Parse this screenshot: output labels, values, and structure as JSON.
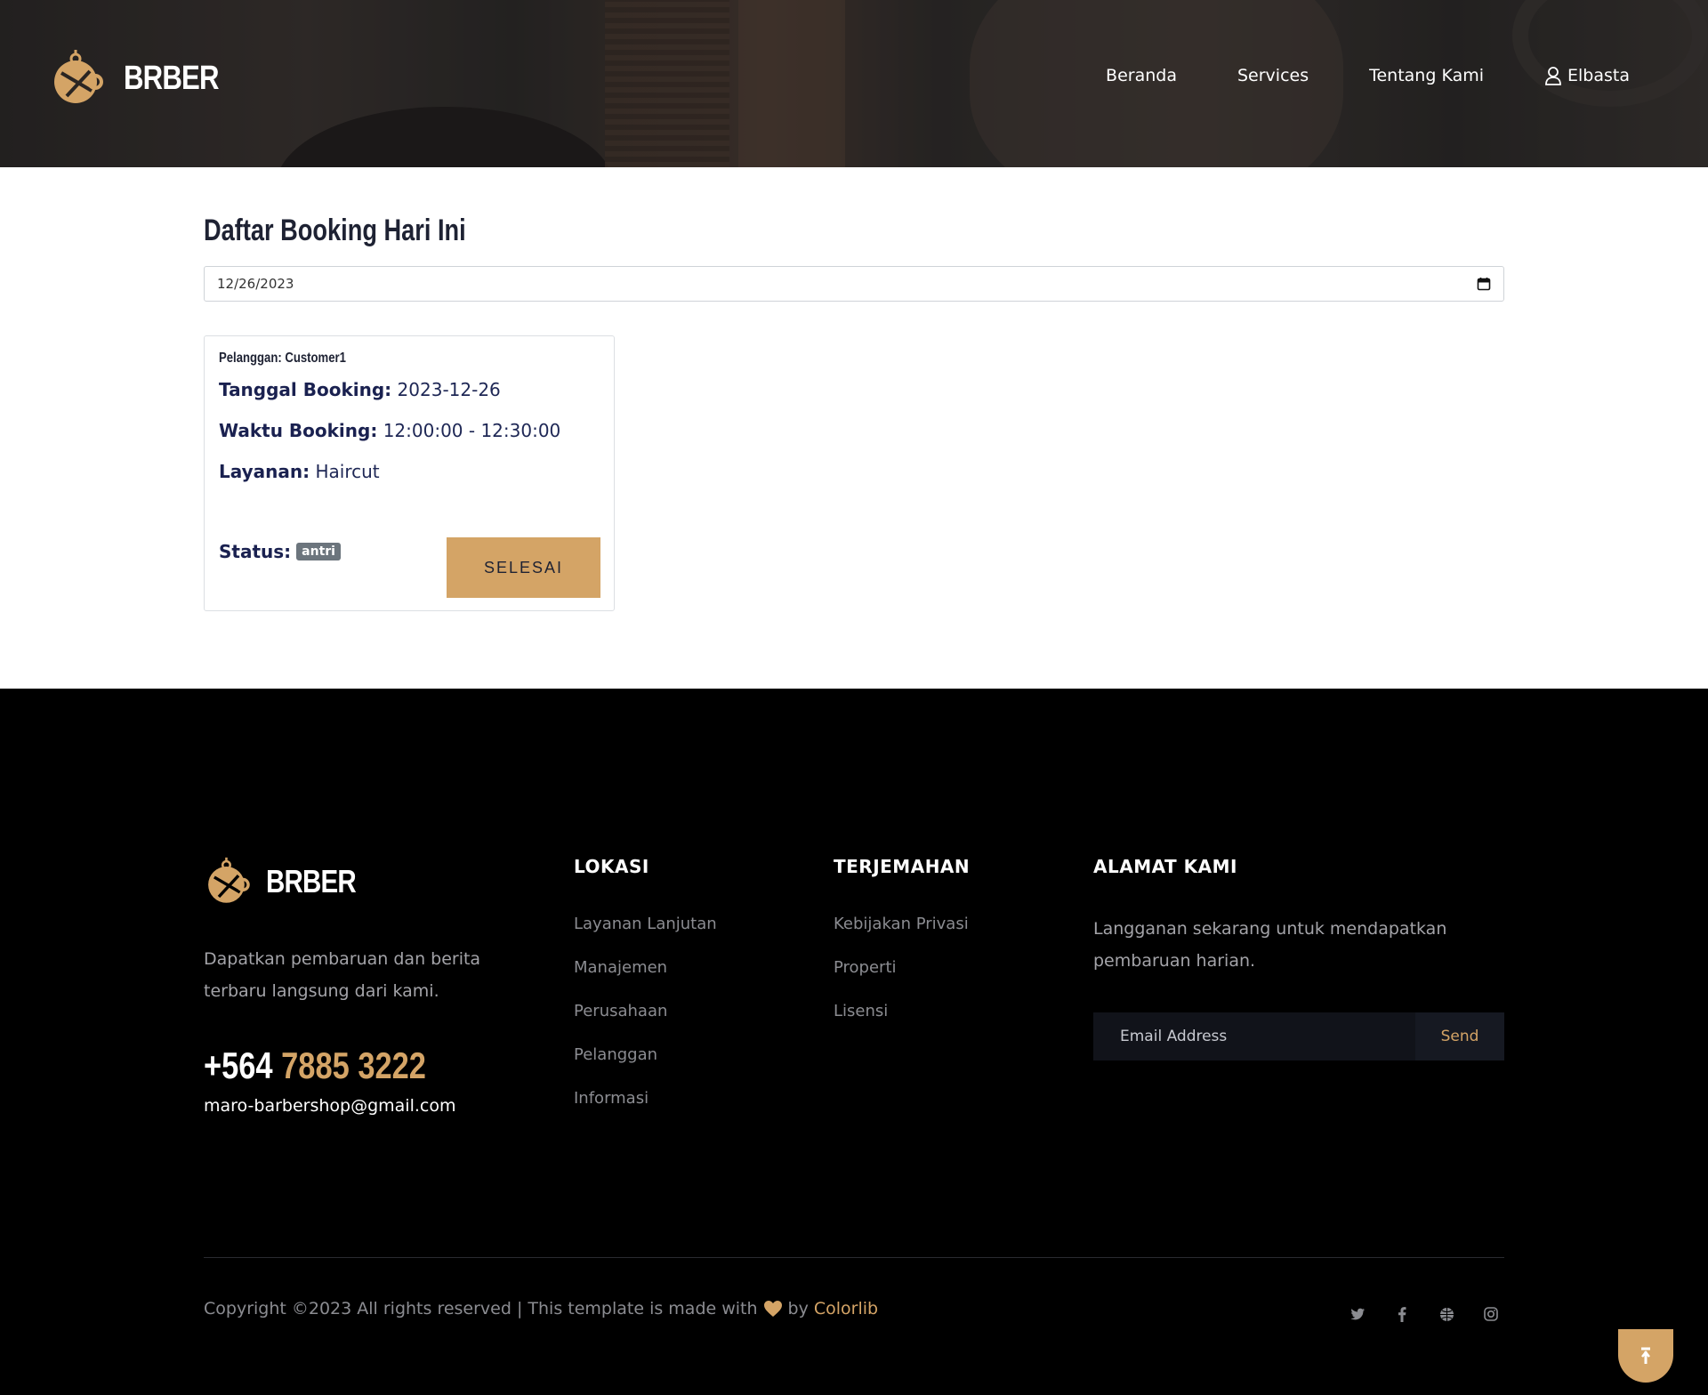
{
  "header": {
    "brand": "BRBER",
    "nav": [
      {
        "label": "Beranda"
      },
      {
        "label": "Services"
      },
      {
        "label": "Tentang Kami"
      },
      {
        "label": "Elbasta"
      }
    ]
  },
  "main": {
    "title": "Daftar Booking Hari Ini",
    "date_value": "12/26/2023",
    "booking": {
      "customer": "Pelanggan: Customer1",
      "date_label": "Tanggal Booking:",
      "date_value": "2023-12-26",
      "time_label": "Waktu Booking:",
      "time_value": "12:00:00 - 12:30:00",
      "service_label": "Layanan:",
      "service_value": "Haircut",
      "status_label": "Status:",
      "status_value": "antri",
      "done_button": "SELESAI"
    }
  },
  "footer": {
    "brand": "BRBER",
    "description": "Dapatkan pembaruan dan berita terbaru langsung dari kami.",
    "phone_prefix": "+564",
    "phone_number": "7885 3222",
    "email": "maro-barbershop@gmail.com",
    "columns": [
      {
        "title": "LOKASI",
        "items": [
          "Layanan Lanjutan",
          "Manajemen",
          "Perusahaan",
          "Pelanggan",
          "Informasi"
        ]
      },
      {
        "title": "TERJEMAHAN",
        "items": [
          "Kebijakan Privasi",
          "Properti",
          "Lisensi"
        ]
      }
    ],
    "address": {
      "title": "ALAMAT KAMI",
      "text": "Langganan sekarang untuk mendapatkan pembaruan harian.",
      "email_placeholder": "Email Address",
      "send_label": "Send"
    },
    "copyright_text": "Copyright ©2023 All rights reserved | This template is made with",
    "copyright_by": "by",
    "copyright_link": "Colorlib",
    "socials": [
      "twitter-icon",
      "facebook-icon",
      "globe-icon",
      "instagram-icon"
    ]
  },
  "colors": {
    "accent": "#d4a466",
    "footer_bg": "#000000",
    "title": "#1e2233",
    "status_badge": "#6c757d"
  }
}
